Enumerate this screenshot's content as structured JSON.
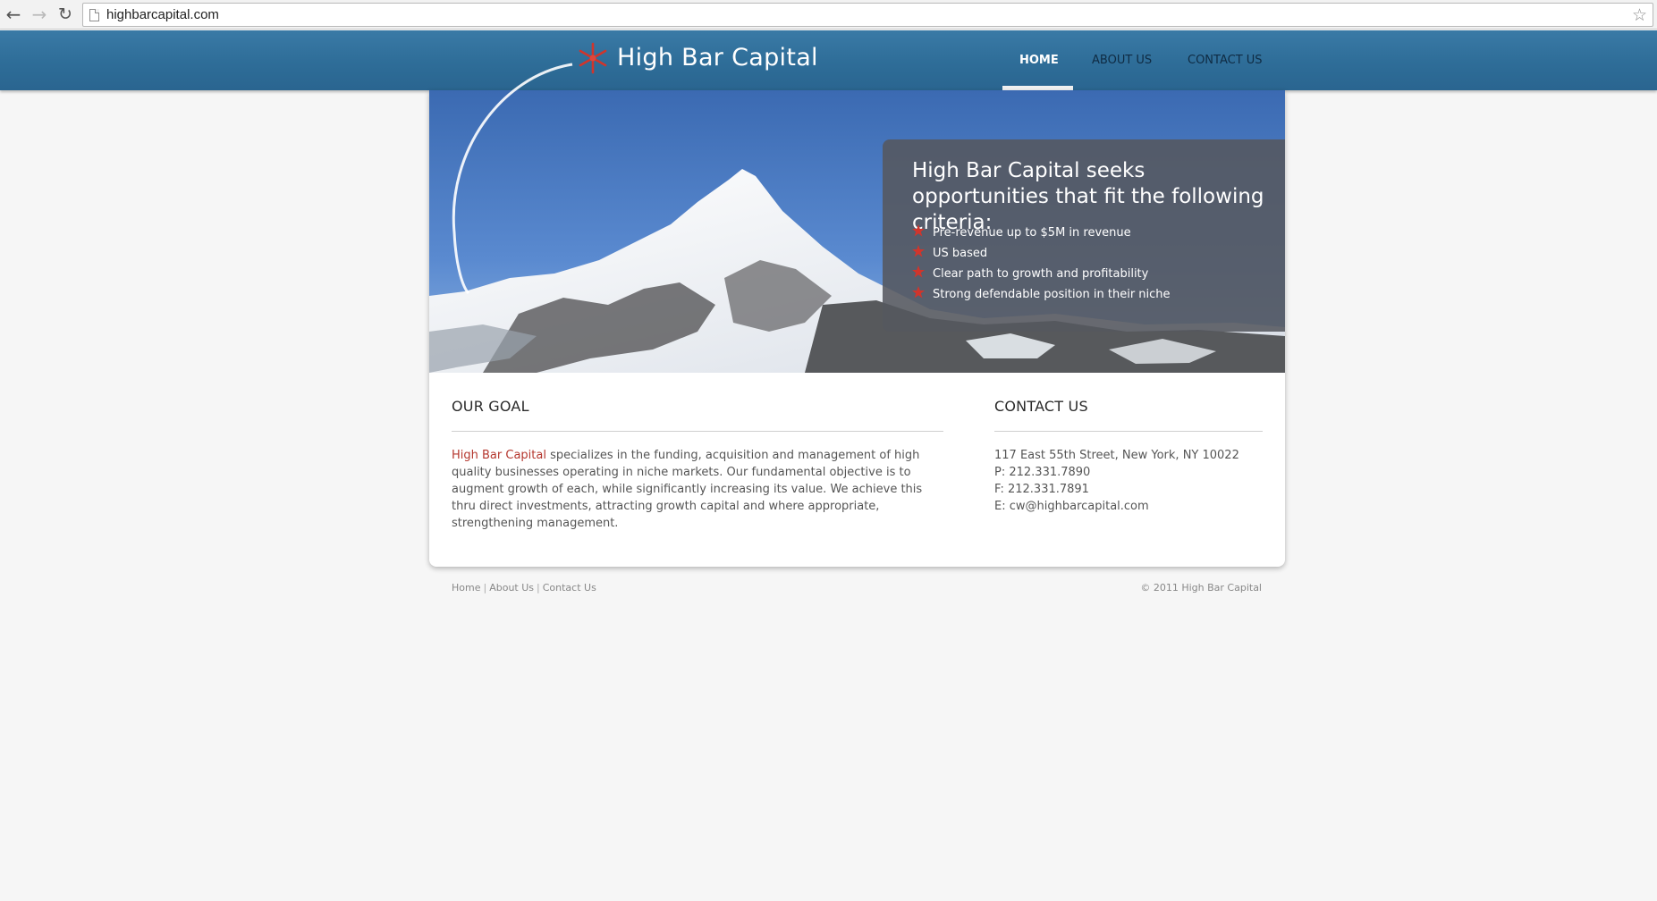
{
  "browser": {
    "url": "highbarcapital.com",
    "back_icon": "back-arrow-icon",
    "forward_icon": "forward-arrow-icon",
    "reload_icon": "reload-icon",
    "bookmark_icon": "star-icon"
  },
  "header": {
    "brand": "High Bar Capital",
    "nav": [
      {
        "label": "HOME",
        "active": true
      },
      {
        "label": "ABOUT US",
        "active": false
      },
      {
        "label": "CONTACT US",
        "active": false
      }
    ]
  },
  "hero": {
    "title": "High Bar Capital seeks opportunities that fit the following criteria:",
    "criteria": [
      "Pre-revenue up to $5M in revenue",
      "US based",
      "Clear path to growth and profitability",
      "Strong defendable position in their niche"
    ]
  },
  "goal": {
    "heading": "OUR GOAL",
    "brand": "High Bar Capital",
    "text": " specializes in the funding, acquisition and management of high quality businesses operating in niche markets. Our fundamental objective is to augment growth of each, while significantly increasing its value. We achieve this thru direct investments, attracting growth capital and where appropriate, strengthening management."
  },
  "contact": {
    "heading": "CONTACT US",
    "address": "117 East 55th Street, New York, NY 10022",
    "phone": "P: 212.331.7890",
    "fax": "F: 212.331.7891",
    "email": "E: cw@highbarcapital.com"
  },
  "footer": {
    "links": [
      "Home",
      "About Us",
      "Contact Us"
    ],
    "copyright": "© 2011 High Bar Capital"
  },
  "colors": {
    "header_blue": "#2e6d98",
    "accent_red": "#c8372d",
    "background": "#f6f6f6"
  }
}
